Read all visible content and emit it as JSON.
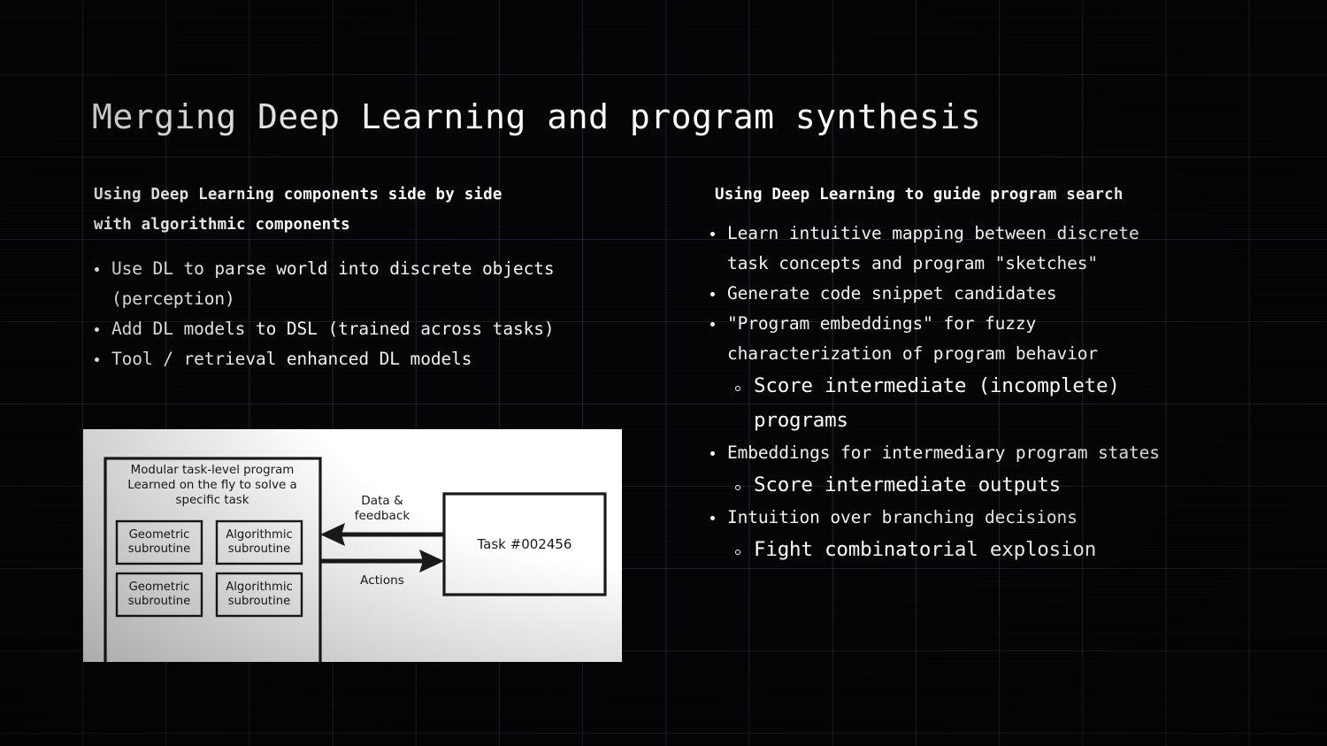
{
  "slide": {
    "title": "Merging Deep Learning and program synthesis",
    "background_color": "#050306",
    "grid_line_color": "#9696be",
    "text_color": "#ffffff"
  },
  "left_column": {
    "heading_line1": "Using Deep Learning components side by side",
    "heading_line2": "with algorithmic components",
    "bullets": [
      {
        "line1": "Use DL to parse world into discrete objects",
        "line2": "(perception)"
      },
      {
        "line1": "Add DL models to DSL (trained across tasks)",
        "line2": ""
      },
      {
        "line1": "Tool / retrieval enhanced DL models",
        "line2": ""
      }
    ]
  },
  "right_column": {
    "heading": "Using Deep Learning to guide program search",
    "bullets": [
      {
        "line1": "Learn intuitive mapping between discrete",
        "line2": "task concepts and program \"sketches\"",
        "sub": []
      },
      {
        "line1": "Generate code snippet candidates",
        "line2": "",
        "sub": []
      },
      {
        "line1": "\"Program embeddings\" for fuzzy",
        "line2": "characterization of program behavior",
        "sub": [
          {
            "line1": "Score intermediate (incomplete)",
            "line2": "programs"
          }
        ]
      },
      {
        "line1": "Embeddings for intermediary program states",
        "line2": "",
        "sub": [
          {
            "line1": "Score intermediate outputs",
            "line2": ""
          }
        ]
      },
      {
        "line1": "Intuition over branching decisions",
        "line2": "",
        "sub": [
          {
            "line1": "Fight combinatorial explosion",
            "line2": ""
          }
        ]
      }
    ]
  },
  "figure": {
    "background_color": "#ffffff",
    "stroke_color": "#1a1a1a",
    "program_box": {
      "caption_line1": "Modular task-level program",
      "caption_line2": "Learned on the fly to solve a",
      "caption_line3": "specific task",
      "subroutines": [
        {
          "line1": "Geometric",
          "line2": "subroutine"
        },
        {
          "line1": "Algorithmic",
          "line2": "subroutine"
        },
        {
          "line1": "Geometric",
          "line2": "subroutine"
        },
        {
          "line1": "Algorithmic",
          "line2": "subroutine"
        }
      ]
    },
    "task_box": {
      "label": "Task #002456"
    },
    "arrows": [
      {
        "label_line1": "Data &",
        "label_line2": "feedback",
        "direction": "right-to-left"
      },
      {
        "label_line1": "Actions",
        "label_line2": "",
        "direction": "left-to-right"
      }
    ]
  }
}
